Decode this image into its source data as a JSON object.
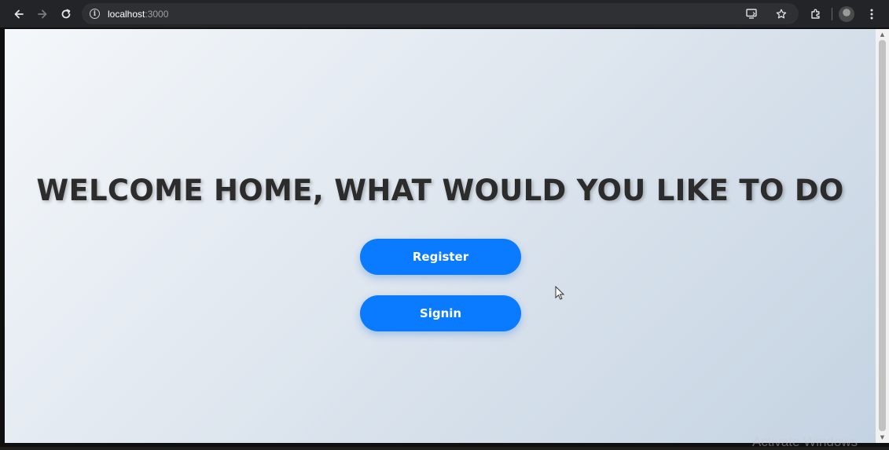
{
  "browser": {
    "url_host": "localhost",
    "url_port": ":3000",
    "icons": {
      "back": "back-arrow-icon",
      "forward": "forward-arrow-icon",
      "reload": "reload-icon",
      "site_info": "info-icon",
      "install": "install-app-icon",
      "bookmark": "star-icon",
      "extensions": "puzzle-icon",
      "profile": "avatar",
      "menu": "kebab-menu-icon"
    }
  },
  "page": {
    "heading": "WELCOME HOME, WHAT WOULD YOU LIKE TO DO",
    "buttons": {
      "register_label": "Register",
      "signin_label": "Signin"
    }
  },
  "os": {
    "watermark": "Activate Windows"
  },
  "colors": {
    "button_bg": "#0a7bff",
    "button_text": "#ffffff",
    "heading_text": "#2c2c2c",
    "toolbar_bg": "#232428"
  }
}
